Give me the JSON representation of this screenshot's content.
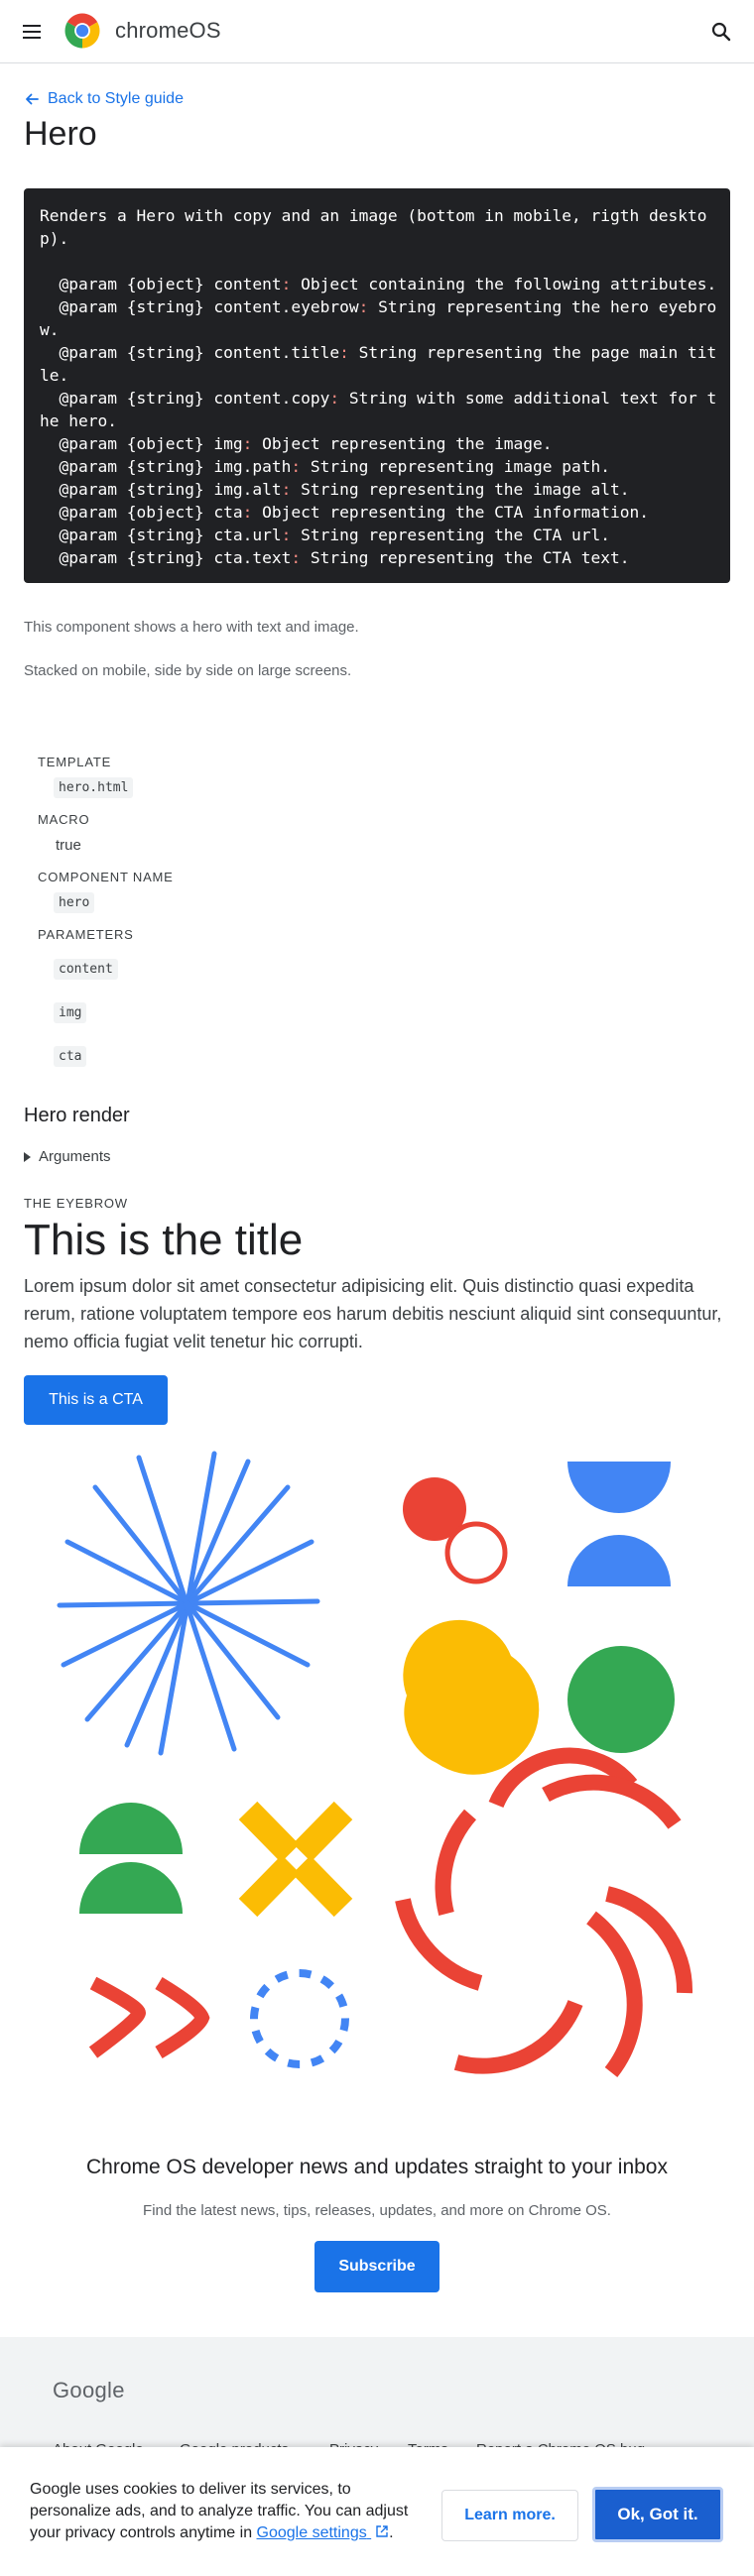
{
  "header": {
    "brand": "chromeOS",
    "menu_icon": "hamburger-menu-icon",
    "search_icon": "search-icon"
  },
  "main": {
    "back_link": "Back to Style guide",
    "page_title": "Hero",
    "code_lines": [
      "Renders a Hero with copy and an image (bottom in mobile, rigth deskto",
      "p).",
      "",
      "  @param {object} content: Object containing the following attributes.",
      "  @param {string} content.eyebrow: String representing the hero eyebro",
      "w.",
      "  @param {string} content.title: String representing the page main tit",
      "le.",
      "  @param {string} content.copy: String with some additional text for t",
      "he hero.",
      "  @param {object} img: Object representing the image.",
      "  @param {string} img.path: String representing image path.",
      "  @param {string} img.alt: String representing the image alt.",
      "  @param {object} cta: Object representing the CTA information.",
      "  @param {string} cta.url: String representing the CTA url.",
      "  @param {string} cta.text: String representing the CTA text."
    ],
    "description_1": "This component shows a hero with text and image.",
    "description_2": "Stacked on mobile, side by side on large screens."
  },
  "meta": {
    "template_label": "TEMPLATE",
    "template_value": "hero.html",
    "macro_label": "MACRO",
    "macro_value": "true",
    "component_label": "COMPONENT NAME",
    "component_value": "hero",
    "parameters_label": "PARAMETERS",
    "parameters": [
      "content",
      "img",
      "cta"
    ]
  },
  "render": {
    "heading": "Hero render",
    "arguments": "Arguments",
    "eyebrow": "THE EYEBROW",
    "title": "This is the title",
    "copy": "Lorem ipsum dolor sit amet consectetur adipisicing elit. Quis distinctio quasi expedita rerum, ratione voluptatem tempore eos harum debitis nesciunt aliquid sint consequuntur, nemo officia fugiat velit tenetur hic corrupti.",
    "cta": "This is a CTA"
  },
  "newsletter": {
    "title": "Chrome OS developer news and updates straight to your inbox",
    "copy": "Find the latest news, tips, releases, updates, and more on Chrome OS.",
    "button": "Subscribe"
  },
  "footer": {
    "logo": "Google",
    "links": [
      "About Google",
      "Google products",
      "Privacy",
      "Terms",
      "Report a Chrome OS bug"
    ]
  },
  "cookie": {
    "text_1": "Google uses cookies to deliver its services, to personalize ads, and to analyze traffic. You can adjust your privacy controls anytime in ",
    "link": "Google settings",
    "text_2": ".",
    "learn_more": "Learn more.",
    "ok": "Ok, Got it."
  },
  "colors": {
    "accent": "#1a73e8",
    "red": "#ea4335",
    "blue": "#4285f4",
    "yellow": "#fbbc04",
    "green": "#34a853"
  }
}
